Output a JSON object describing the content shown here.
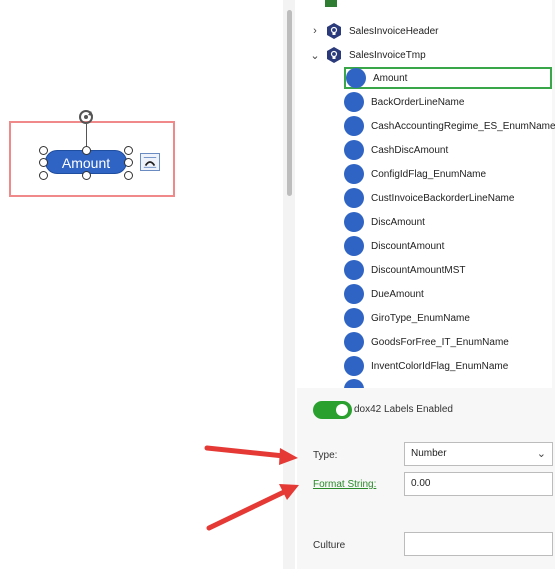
{
  "canvas": {
    "shape_label": "Amount"
  },
  "tree": {
    "parents": [
      {
        "label": "SalesInvoiceHeader",
        "expanded": false
      },
      {
        "label": "SalesInvoiceTmp",
        "expanded": true
      }
    ],
    "fields": [
      "Amount",
      "BackOrderLineName",
      "CashAccountingRegime_ES_EnumName",
      "CashDiscAmount",
      "ConfigIdFlag_EnumName",
      "CustInvoiceBackorderLineName",
      "DiscAmount",
      "DiscountAmount",
      "DiscountAmountMST",
      "DueAmount",
      "GiroType_EnumName",
      "GoodsForFree_IT_EnumName",
      "InventColorIdFlag_EnumName"
    ],
    "selected": "Amount"
  },
  "settings": {
    "labels_toggle": {
      "label": "dox42 Labels Enabled",
      "on": true
    },
    "type": {
      "label": "Type:",
      "value": "Number"
    },
    "format_string": {
      "label": "Format String:",
      "value": "0.00"
    },
    "culture": {
      "label": "Culture",
      "value": ""
    }
  },
  "colors": {
    "accent_blue": "#2f64c4",
    "toggle_green": "#2aa12f",
    "selection_green": "#3aa64a",
    "link_green": "#2a8a2a",
    "highlight_red": "#f08a8a",
    "arrow_red": "#e53935"
  }
}
